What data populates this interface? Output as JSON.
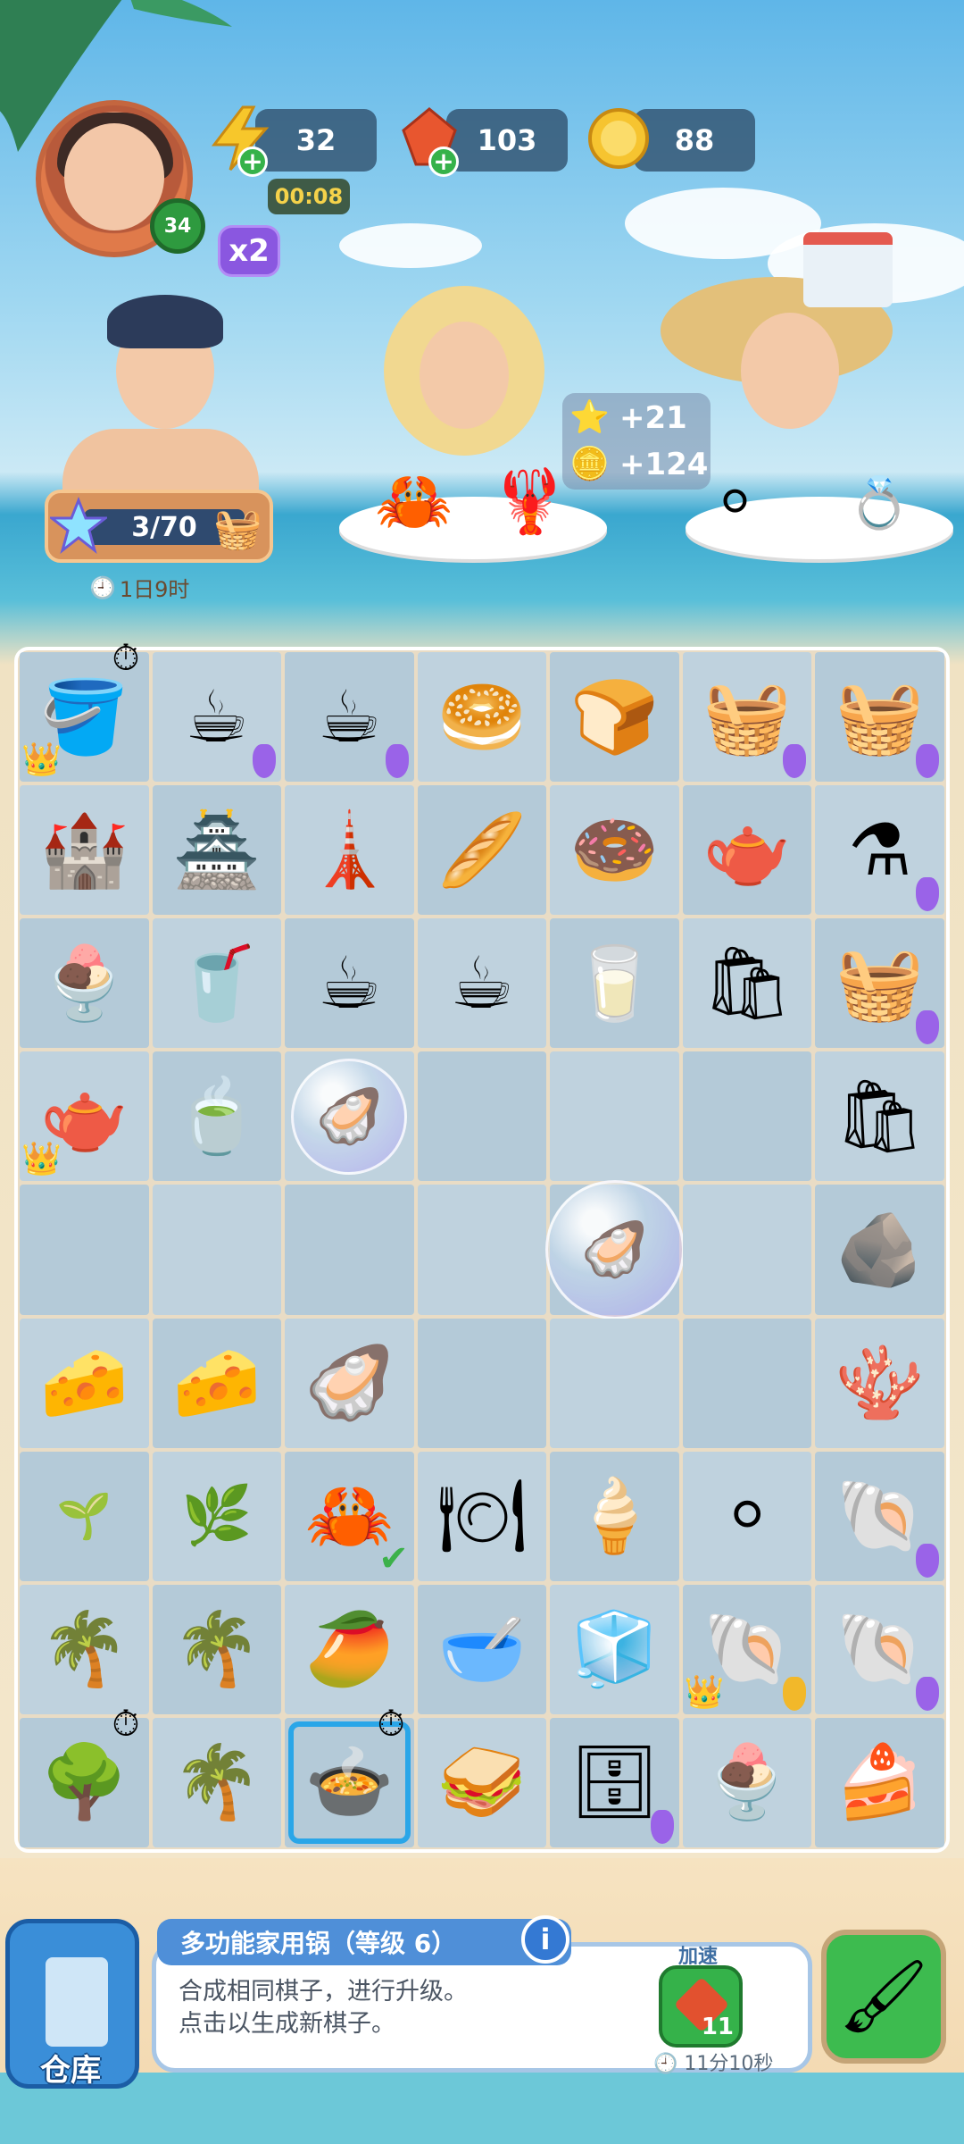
{
  "hud": {
    "level": "34",
    "multiplier": "x2",
    "energy": "32",
    "energy_timer": "00:08",
    "gems": "103",
    "coins": "88"
  },
  "orders": {
    "progress": "3/70",
    "deadline": "1日9时",
    "reward_stars": "+21",
    "reward_coins": "+124"
  },
  "board": {
    "rows": [
      [
        "sand bucket",
        "espresso machine",
        "coffee maker",
        "bagels",
        "buns",
        "grocery basket",
        "grocery basket"
      ],
      [
        "sand castle",
        "sand castle",
        "sand castle",
        "bread rolls",
        "bagel",
        "coffee pot",
        "moka pot"
      ],
      [
        "latte",
        "iced coffee",
        "coffee cup",
        "coffee cup",
        "coffee to go",
        "paper bag",
        "grocery basket"
      ],
      [
        "teapot",
        "tea glass",
        "oyster bubble",
        "",
        "",
        "",
        "grocery bag"
      ],
      [
        "",
        "",
        "",
        "",
        "oyster bubble",
        "",
        "rock"
      ],
      [
        "cheese",
        "cheese",
        "oysters plate",
        "",
        "",
        "",
        "coral rock"
      ],
      [
        "sprout",
        "seedling",
        "crab dish",
        "crab plate",
        "piping bag",
        "pearl",
        "seashell coral"
      ],
      [
        "palm tree",
        "palm tree",
        "mango",
        "mango bowl",
        "ice box",
        "pearl clam",
        "pearl clam"
      ],
      [
        "mango tree",
        "palm tree",
        "multi cooker",
        "sandwich",
        "fridge",
        "ice cream",
        "cake"
      ]
    ]
  },
  "info_panel": {
    "title": "多功能家用锅（等级 6）",
    "info_icon": "i",
    "line1": "合成相同棋子，进行升级。",
    "line2": "点击以生成新棋子。",
    "speed_label": "加速",
    "speed_cost": "11",
    "speed_time": "11分10秒"
  },
  "storage": {
    "label": "仓库"
  },
  "colors": {
    "board_cell": "#bfd2de",
    "accent_blue": "#4f8fd8",
    "accent_green": "#35b24a"
  }
}
